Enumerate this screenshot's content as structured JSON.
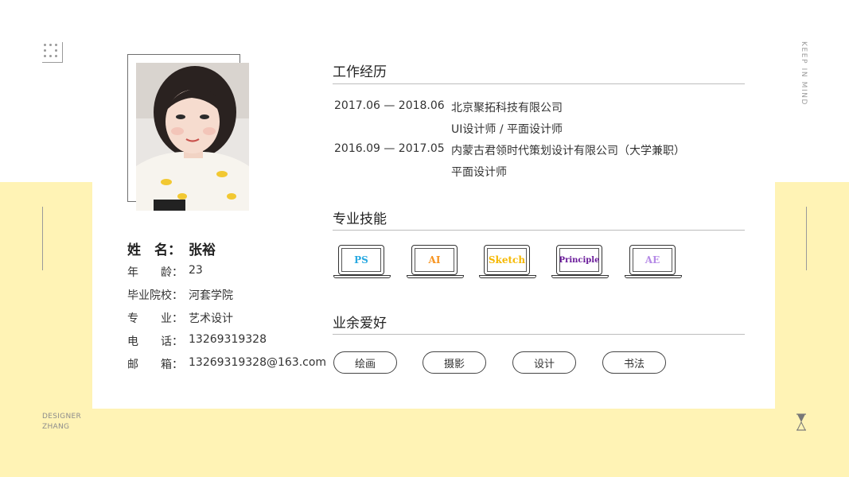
{
  "decor": {
    "keep_in_mind": "KEEP IN MIND",
    "designer_line1": "DESIGNER",
    "designer_line2": "ZHANG"
  },
  "profile": {
    "name_label": "姓　名：",
    "name_value": "张裕",
    "fields": [
      {
        "label": "年　　龄：",
        "value": "23"
      },
      {
        "label": "毕业院校：",
        "value": "河套学院"
      },
      {
        "label": "专　　业：",
        "value": "艺术设计"
      },
      {
        "label": "电　　话：",
        "value": "13269319328"
      },
      {
        "label": "邮　　箱：",
        "value": "13269319328@163.com"
      }
    ]
  },
  "experience": {
    "title": "工作经历",
    "items": [
      {
        "period": "2017.06 — 2018.06",
        "company": "北京聚拓科技有限公司",
        "role": "UI设计师 / 平面设计师"
      },
      {
        "period": "2016.09 — 2017.05",
        "company": "内蒙古君领时代策划设计有限公司（大学兼职）",
        "role": "平面设计师"
      }
    ]
  },
  "skills": {
    "title": "专业技能",
    "items": [
      {
        "label": "PS",
        "color": "#29a9e1"
      },
      {
        "label": "AI",
        "color": "#f7931e"
      },
      {
        "label": "Sketch",
        "color": "#f5b800"
      },
      {
        "label": "Principle",
        "color": "#6a1b9a"
      },
      {
        "label": "AE",
        "color": "#b58ae6"
      }
    ]
  },
  "hobbies": {
    "title": "业余爱好",
    "items": [
      "绘画",
      "摄影",
      "设计",
      "书法"
    ]
  },
  "colors": {
    "accent_band": "#fff3b5"
  }
}
